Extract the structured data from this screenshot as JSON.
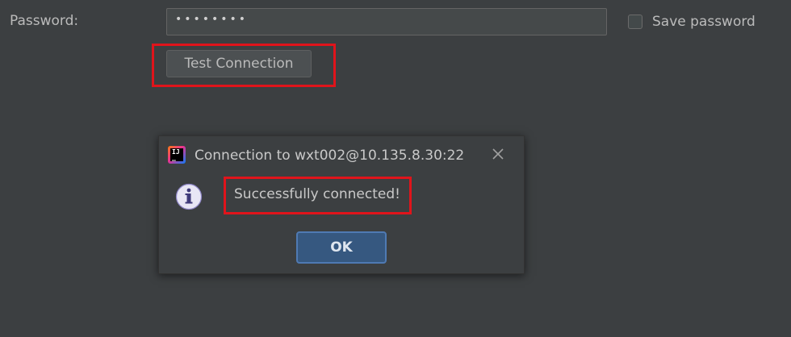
{
  "form": {
    "password_label": "Password:",
    "password_value": "••••••••",
    "save_password_label": "Save password",
    "save_password_checked": false,
    "test_connection_label": "Test Connection"
  },
  "dialog": {
    "title": "Connection to wxt002@10.135.8.30:22",
    "app_icon": "intellij-idea-icon",
    "message_icon": "info-icon",
    "message": "Successfully connected!",
    "ok_label": "OK",
    "close_icon": "close-icon"
  },
  "colors": {
    "background": "#3c3f41",
    "highlight": "#e0141b",
    "ok_button": "#365880"
  }
}
